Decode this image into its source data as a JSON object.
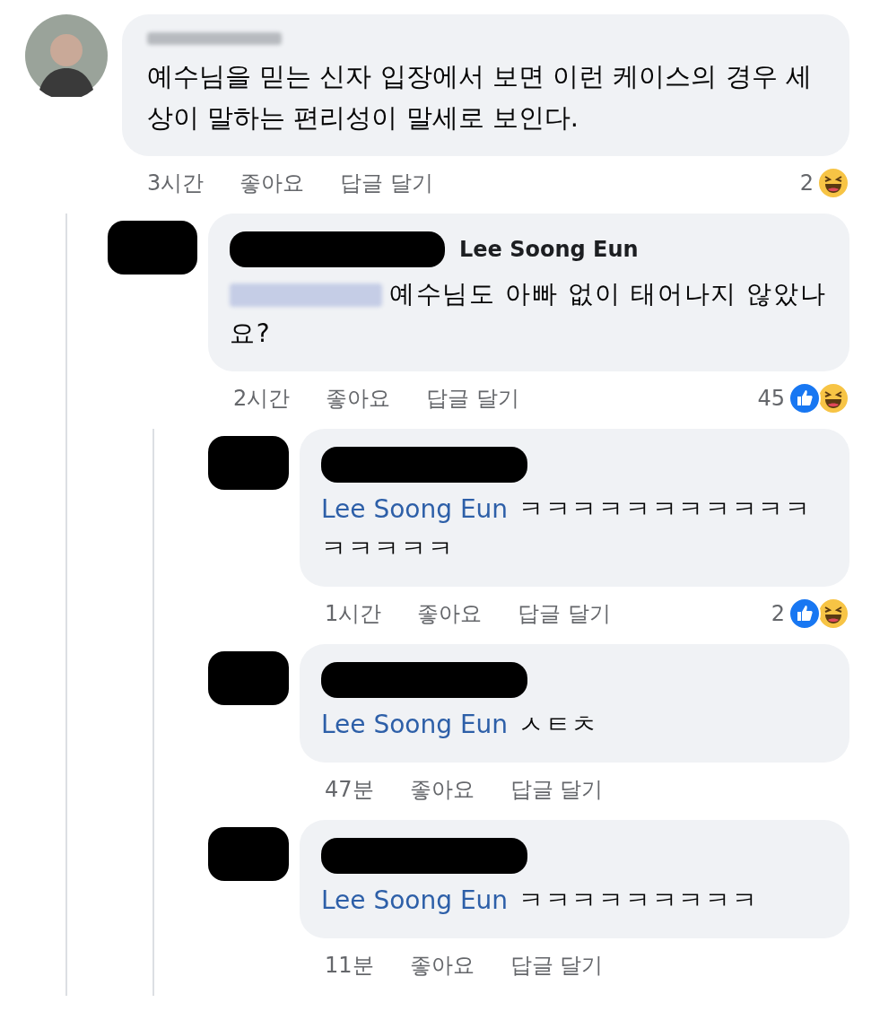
{
  "comment": {
    "text": "예수님을 믿는 신자 입장에서 보면 이런 케이스의 경우  세상이 말하는 편리성이 말세로 보인다.",
    "time": "3시간",
    "like": "좋아요",
    "reply": "답글 달기",
    "reaction_count": "2",
    "reactions": [
      {
        "kind": "haha"
      }
    ],
    "replies": [
      {
        "name": "Lee Soong Eun",
        "text": "예수님도 아빠 없이 태어나지 않았나요?",
        "time": "2시간",
        "like": "좋아요",
        "reply": "답글 달기",
        "reaction_count": "45",
        "reactions": [
          {
            "kind": "like"
          },
          {
            "kind": "haha"
          }
        ],
        "replies": [
          {
            "mention": "Lee Soong Eun",
            "text": "ㅋㅋㅋㅋㅋㅋㅋㅋㅋㅋㅋㅋㅋㅋㅋㅋ",
            "time": "1시간",
            "like": "좋아요",
            "reply": "답글 달기",
            "reaction_count": "2",
            "reactions": [
              {
                "kind": "like"
              },
              {
                "kind": "haha"
              }
            ]
          },
          {
            "mention": "Lee Soong Eun",
            "text": "ㅅㅌㅊ",
            "time": "47분",
            "like": "좋아요",
            "reply": "답글 달기"
          },
          {
            "mention": "Lee Soong Eun",
            "text": "ㅋㅋㅋㅋㅋㅋㅋㅋㅋ",
            "time": "11분",
            "like": "좋아요",
            "reply": "답글 달기"
          }
        ]
      }
    ]
  }
}
